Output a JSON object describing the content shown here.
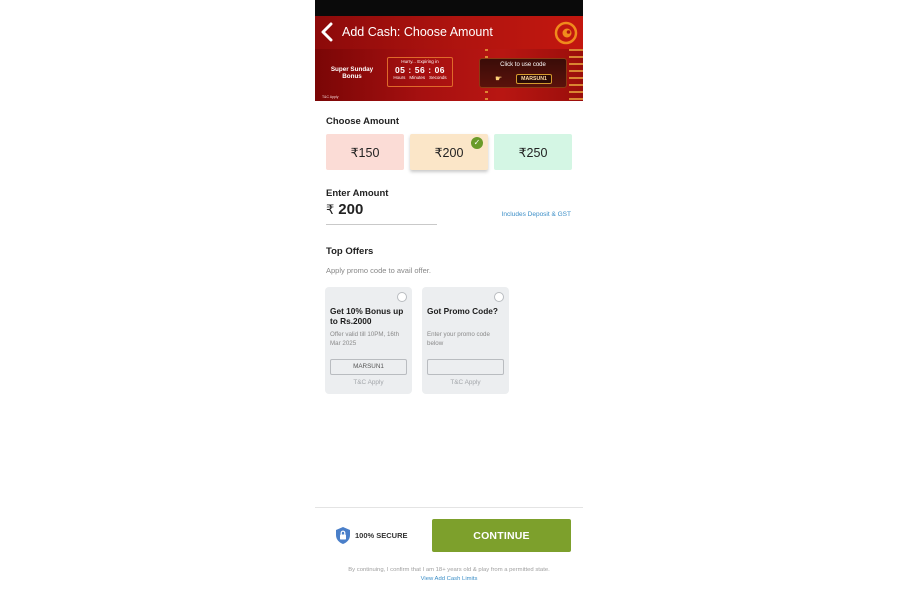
{
  "header": {
    "title": "Add Cash: Choose Amount"
  },
  "promo_banner": {
    "bonus_title": "Super Sunday Bonus",
    "timer_label": "Hurry... Expiring in",
    "timer": {
      "hours": "05",
      "minutes": "56",
      "seconds": "06"
    },
    "timer_units": {
      "hours": "Hours",
      "minutes": "Minutes",
      "seconds": "Seconds"
    },
    "code_prompt": "Click to use code",
    "code": "MARSUN1",
    "tc": "T&C Apply"
  },
  "choose_amount": {
    "title": "Choose Amount",
    "options": [
      {
        "label": "₹150",
        "selected": false
      },
      {
        "label": "₹200",
        "selected": true
      },
      {
        "label": "₹250",
        "selected": false
      }
    ],
    "check_mark": "✓"
  },
  "enter_amount": {
    "title": "Enter Amount",
    "currency": "₹",
    "value": "200",
    "note": "Includes Deposit & GST"
  },
  "top_offers": {
    "title": "Top Offers",
    "subtitle": "Apply promo code to avail offer.",
    "cards": [
      {
        "title": "Get 10% Bonus up to Rs.2000",
        "description": "Offer valid till 10PM, 16th Mar 2025",
        "code": "MARSUN1",
        "tc": "T&C Apply"
      },
      {
        "title": "Got Promo Code?",
        "description": "Enter your promo code below",
        "code": "",
        "tc": "T&C Apply"
      }
    ]
  },
  "footer": {
    "secure_text": "100% SECURE",
    "continue_label": "CONTINUE",
    "disclaimer": "By continuing, I confirm that I am 18+ years old & play from a permitted state.",
    "limits_link": "View Add Cash Limits"
  },
  "colors": {
    "header_red": "#b0140f",
    "continue_green": "#7da02c",
    "link_blue": "#3b8ec7",
    "selected_check": "#6a9b2a"
  },
  "icons": {
    "back": "back-arrow-icon",
    "logo": "brand-logo-icon",
    "shield": "shield-lock-icon",
    "hand": "pointing-hand-icon"
  }
}
